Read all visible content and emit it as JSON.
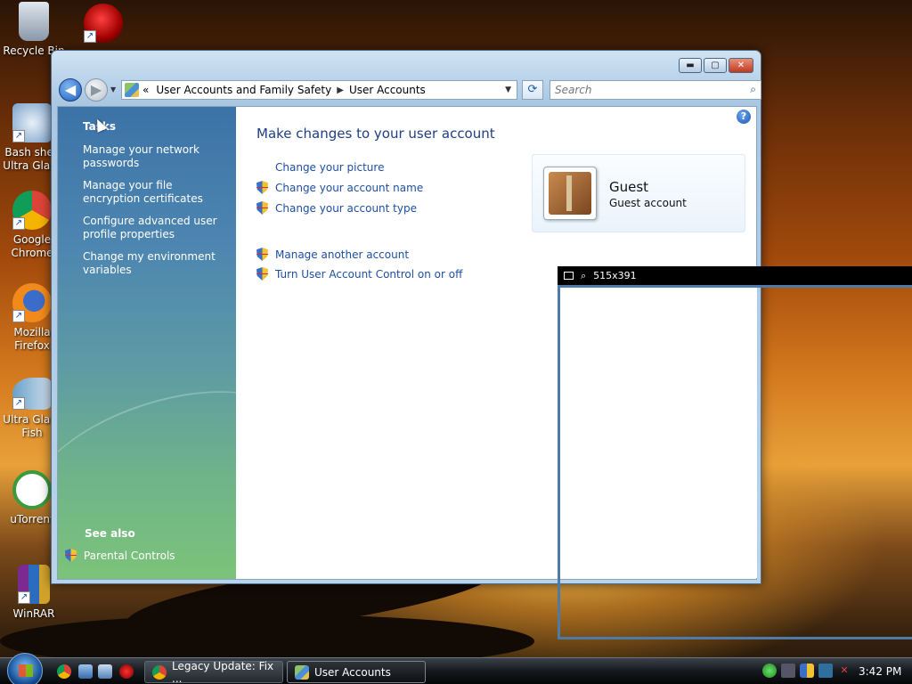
{
  "desktop": {
    "icons": [
      {
        "label": "Recycle Bin",
        "icon": "recycle-bin-icon"
      },
      {
        "label": "",
        "icon": "red-orb-app-icon"
      },
      {
        "label": "Bash shell Ultra Glass",
        "icon": "gear-app-icon"
      },
      {
        "label": "Google Chrome",
        "icon": "chrome-icon"
      },
      {
        "label": "Mozilla Firefox",
        "icon": "firefox-icon"
      },
      {
        "label": "Ultra Glass Fish",
        "icon": "fish-icon"
      },
      {
        "label": "uTorrent",
        "icon": "utorrent-icon"
      },
      {
        "label": "WinRAR",
        "icon": "winrar-icon"
      }
    ],
    "shortcut_arrow": "↗"
  },
  "window": {
    "title_buttons": {
      "minimize": "▬",
      "maximize": "▢",
      "close": "✕"
    },
    "nav": {
      "back": "◀",
      "forward": "▶",
      "dropdown": "▼"
    },
    "address": {
      "chevron": "«",
      "crumbs": [
        "User Accounts and Family Safety",
        "User Accounts"
      ],
      "separator": "▶",
      "dropdown": "▼"
    },
    "refresh": "⟳",
    "search": {
      "placeholder": "Search",
      "icon": "⌕"
    },
    "help": "?"
  },
  "leftpane": {
    "tasks_heading": "Tasks",
    "tasks": [
      "Manage your network passwords",
      "Manage your file encryption certificates",
      "Configure advanced user profile properties",
      "Change my environment variables"
    ],
    "see_also_heading": "See also",
    "parental_controls": "Parental Controls"
  },
  "main": {
    "title": "Make changes to your user account",
    "links": [
      {
        "label": "Change your picture",
        "shield": false
      },
      {
        "label": "Change your account name",
        "shield": true
      },
      {
        "label": "Change your account type",
        "shield": true
      },
      {
        "label": "Manage another account",
        "shield": true
      },
      {
        "label": "Turn User Account Control on or off",
        "shield": true
      }
    ],
    "account": {
      "name": "Guest",
      "type": "Guest account"
    }
  },
  "magnifier": {
    "size_label": "515x391"
  },
  "taskbar": {
    "buttons": [
      {
        "label": "Legacy Update: Fix ..."
      },
      {
        "label": "User Accounts"
      }
    ],
    "clock": "3:42 PM"
  },
  "colors": {
    "link": "#1e4fa0",
    "title": "#1e3f82",
    "leftpane_top": "#3c73a8",
    "leftpane_bottom": "#7cc37a"
  }
}
